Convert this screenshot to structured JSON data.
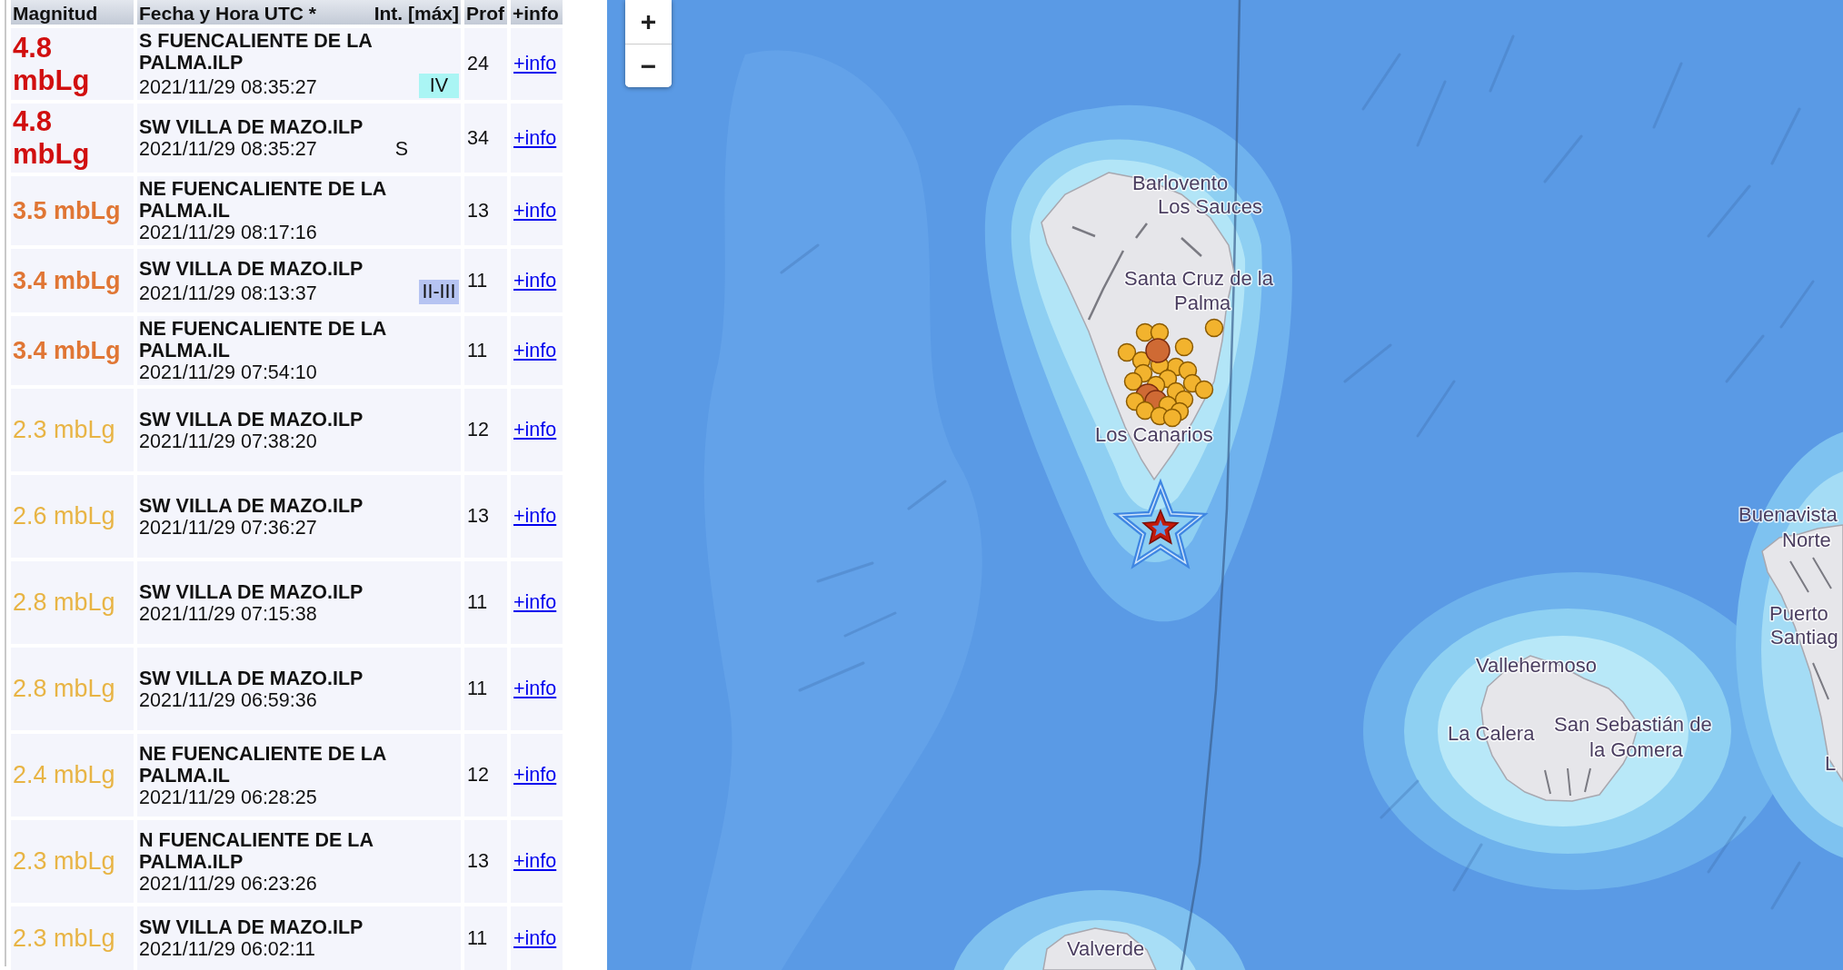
{
  "table": {
    "columns": [
      "Magnitud",
      "Fecha y Hora UTC *",
      "Int. [máx]",
      "Prof",
      "+info"
    ],
    "rows": [
      {
        "magnitude": "4.8 mbLg",
        "kind": "strong",
        "color": "#d10f0f",
        "location": "S FUENCALIENTE DE LA PALMA.ILP",
        "datetime": "2021/11/29 08:35:27",
        "intensity": {
          "text": "IV",
          "color": "#aaf5f4"
        },
        "depth": "24",
        "link": "+info"
      },
      {
        "magnitude": "4.8 mbLg",
        "kind": "strong",
        "color": "#d10f0f",
        "location": "SW VILLA DE MAZO.ILP",
        "datetime": "2021/11/29 08:35:27",
        "intensity": {
          "text": "S"
        },
        "depth": "34",
        "link": "+info"
      },
      {
        "magnitude": "3.5 mbLg",
        "kind": "moderate",
        "color": "#e07634",
        "location": "NE FUENCALIENTE DE LA PALMA.IL",
        "datetime": "2021/11/29 08:17:16",
        "depth": "13",
        "link": "+info"
      },
      {
        "magnitude": "3.4 mbLg",
        "kind": "moderate",
        "color": "#e07634",
        "location": "SW VILLA DE MAZO.ILP",
        "datetime": "2021/11/29 08:13:37",
        "intensity": {
          "text": "II-III",
          "color": "#b6c4f2"
        },
        "depth": "11",
        "link": "+info"
      },
      {
        "magnitude": "3.4 mbLg",
        "kind": "moderate",
        "color": "#e07634",
        "location": "NE FUENCALIENTE DE LA PALMA.IL",
        "datetime": "2021/11/29 07:54:10",
        "depth": "11",
        "link": "+info"
      },
      {
        "magnitude": "2.3 mbLg",
        "kind": "light",
        "color": "#e8b444",
        "location": "SW VILLA DE MAZO.ILP",
        "datetime": "2021/11/29 07:38:20",
        "depth": "12",
        "link": "+info"
      },
      {
        "magnitude": "2.6 mbLg",
        "kind": "light",
        "color": "#e8b444",
        "location": "SW VILLA DE MAZO.ILP",
        "datetime": "2021/11/29 07:36:27",
        "depth": "13",
        "link": "+info"
      },
      {
        "magnitude": "2.8 mbLg",
        "kind": "light",
        "color": "#e8b444",
        "location": "SW VILLA DE MAZO.ILP",
        "datetime": "2021/11/29 07:15:38",
        "depth": "11",
        "link": "+info"
      },
      {
        "magnitude": "2.8 mbLg",
        "kind": "light",
        "color": "#e8b444",
        "location": "SW VILLA DE MAZO.ILP",
        "datetime": "2021/11/29 06:59:36",
        "depth": "11",
        "link": "+info"
      },
      {
        "magnitude": "2.4 mbLg",
        "kind": "light",
        "color": "#e8b444",
        "location": "NE FUENCALIENTE DE LA PALMA.IL",
        "datetime": "2021/11/29 06:28:25",
        "depth": "12",
        "link": "+info"
      },
      {
        "magnitude": "2.3 mbLg",
        "kind": "light",
        "color": "#e8b444",
        "location": "N FUENCALIENTE DE LA PALMA.ILP",
        "datetime": "2021/11/29 06:23:26",
        "depth": "13",
        "link": "+info"
      },
      {
        "magnitude": "2.3 mbLg",
        "kind": "light",
        "color": "#e8b444",
        "location": "SW VILLA DE MAZO.ILP",
        "datetime": "2021/11/29 06:02:11",
        "depth": "11",
        "link": "+info"
      }
    ]
  },
  "map": {
    "zoom_controls": [
      {
        "label": "+"
      },
      {
        "label": "−"
      }
    ],
    "labels": [
      {
        "lines": [
          "Barlovento"
        ]
      },
      {
        "lines": [
          "Los Sauces"
        ]
      },
      {
        "lines": [
          "Santa Cruz de la",
          "Palma"
        ]
      },
      {
        "lines": [
          "Los Canarios"
        ]
      },
      {
        "lines": [
          "Buenavista",
          "Norte"
        ]
      },
      {
        "lines": [
          "Puerto",
          "Santiag"
        ]
      },
      {
        "lines": [
          "Vallehermoso"
        ]
      },
      {
        "lines": [
          "La Calera"
        ]
      },
      {
        "lines": [
          "San Sebastián de",
          "la Gomera"
        ]
      },
      {
        "lines": [
          "L"
        ]
      },
      {
        "lines": [
          "Valverde"
        ]
      }
    ]
  }
}
